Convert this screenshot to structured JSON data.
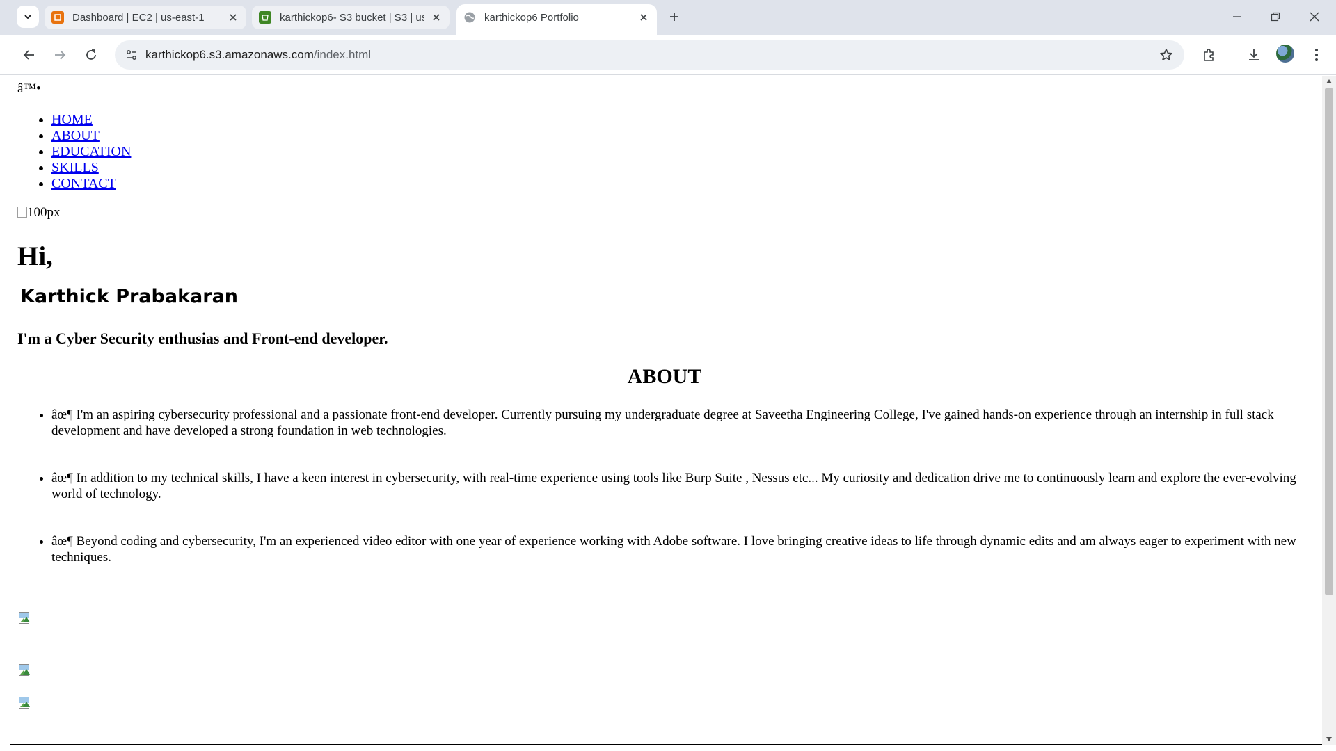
{
  "browser": {
    "tabs": [
      {
        "title": "Dashboard | EC2 | us-east-1",
        "icon": "aws-ec2-icon",
        "color": "#e8730f"
      },
      {
        "title": "karthickop6- S3 bucket | S3 | us",
        "icon": "aws-s3-icon",
        "color": "#3f8624"
      },
      {
        "title": "karthickop6 Portfolio",
        "icon": "globe-icon",
        "color": "#9aa0a6"
      }
    ],
    "url_host": "karthickop6.s3.amazonaws.com",
    "url_path": "/index.html"
  },
  "page": {
    "logo": "â™•",
    "nav": [
      "HOME",
      "ABOUT",
      "EDUCATION",
      "SKILLS",
      "CONTACT"
    ],
    "hero_img_alt": "100px",
    "greeting": "Hi,",
    "name": "Karthick Prabakaran",
    "tagline": "I'm a Cyber Security enthusias and Front-end developer.",
    "about_title": "ABOUT",
    "about_items": [
      "âœ¶ I'm an aspiring cybersecurity professional and a passionate front-end developer. Currently pursuing my undergraduate degree at Saveetha Engineering College, I've gained hands-on experience through an internship in full stack development and have developed a strong foundation in web technologies.",
      "âœ¶ In addition to my technical skills, I have a keen interest in cybersecurity, with real-time experience using tools like Burp Suite , Nessus etc... My curiosity and dedication drive me to continuously learn and explore the ever-evolving world of technology.",
      "âœ¶ Beyond coding and cybersecurity, I'm an experienced video editor with one year of experience working with Adobe software. I love bringing creative ideas to life through dynamic edits and am always eager to experiment with new techniques."
    ]
  }
}
